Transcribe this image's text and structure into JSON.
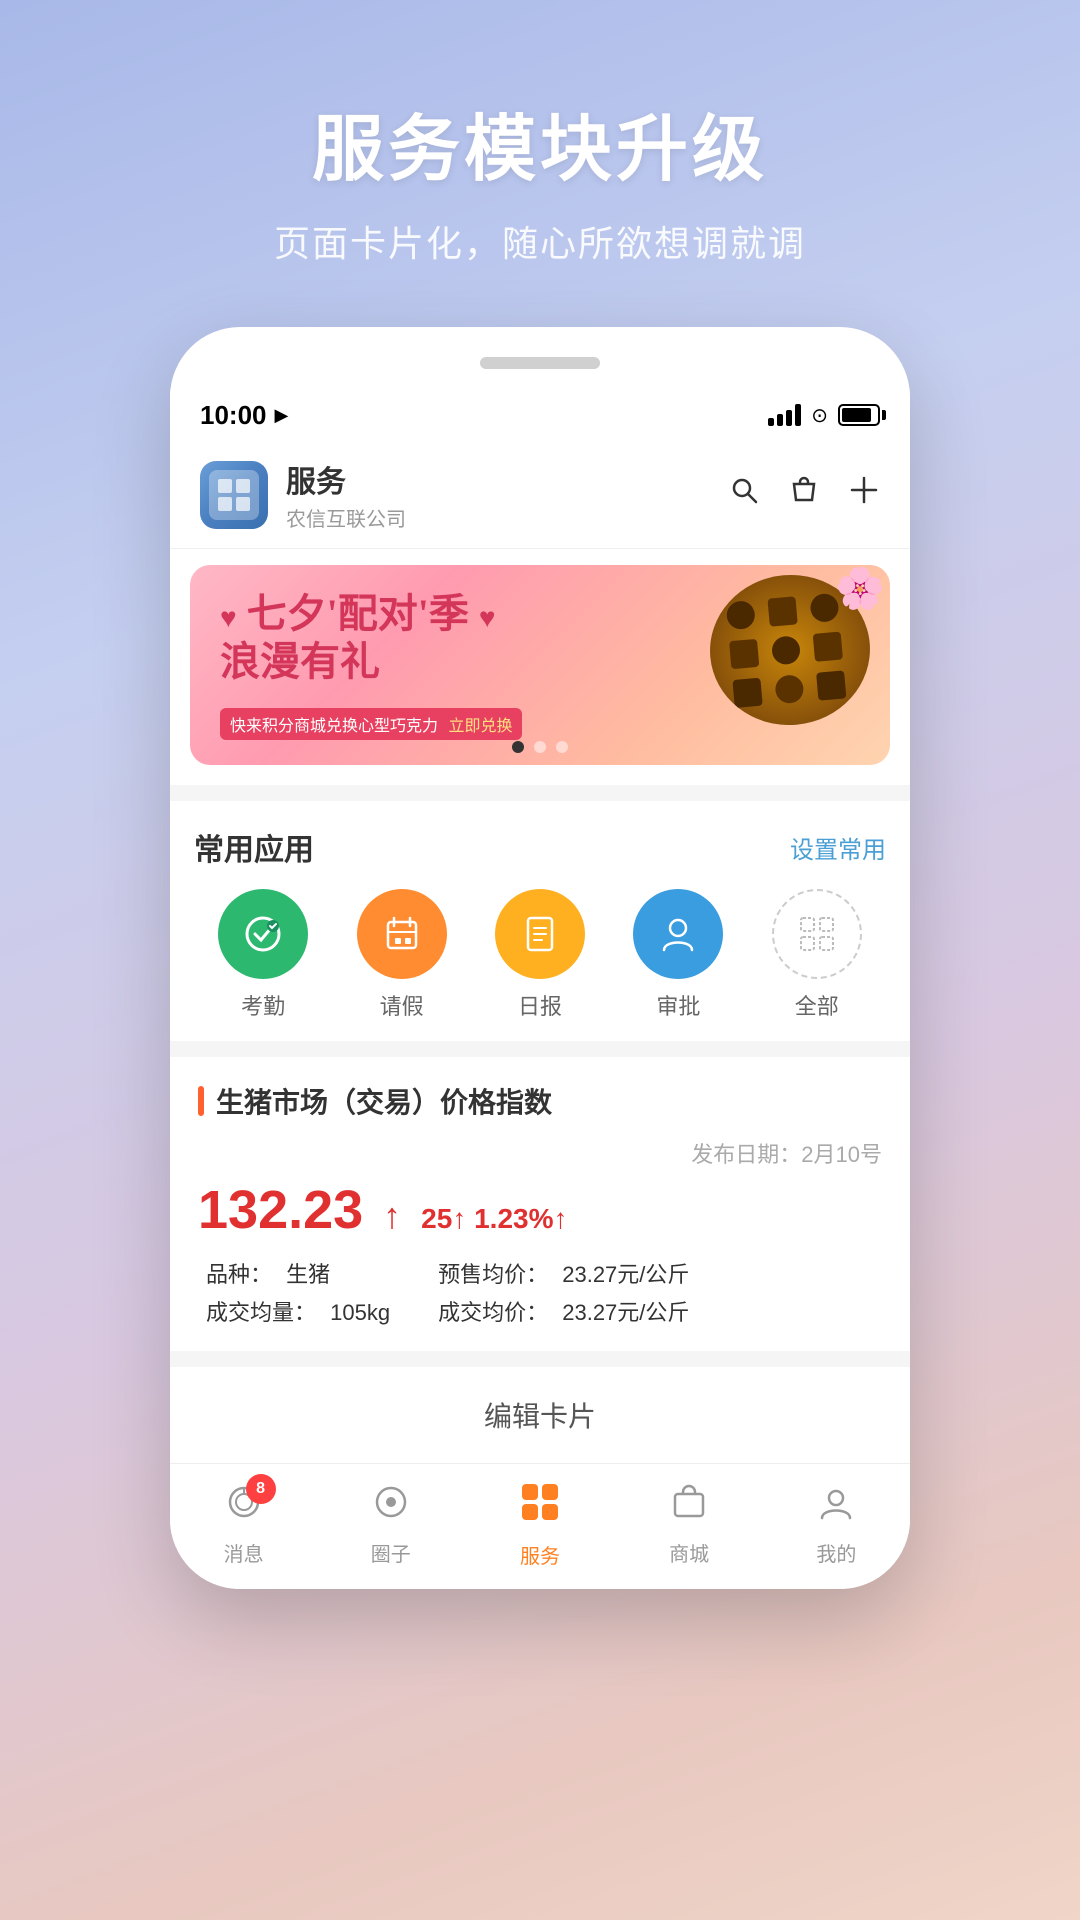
{
  "hero": {
    "title": "服务模块升级",
    "subtitle": "页面卡片化，随心所欲想调就调"
  },
  "status_bar": {
    "time": "10:00",
    "location_icon": "▶"
  },
  "app_header": {
    "title": "服务",
    "subtitle": "农信互联公司",
    "icons": [
      "search",
      "bag",
      "plus"
    ]
  },
  "banner": {
    "title_line1": "七夕'配对'季",
    "title_line2": "浪漫有礼",
    "tag": "快来积分商城兑换心型巧克力",
    "tag_link": "立即兑换",
    "dots": [
      true,
      false,
      false
    ]
  },
  "common_apps": {
    "section_title": "常用应用",
    "action_label": "设置常用",
    "items": [
      {
        "label": "考勤",
        "icon": "bluetooth",
        "color": "green"
      },
      {
        "label": "请假",
        "icon": "calendar",
        "color": "orange"
      },
      {
        "label": "日报",
        "icon": "note",
        "color": "yellow"
      },
      {
        "label": "审批",
        "icon": "person",
        "color": "blue"
      },
      {
        "label": "全部",
        "icon": "grid",
        "color": "outline"
      }
    ]
  },
  "market": {
    "title": "生猪市场（交易）价格指数",
    "date_label": "发布日期：2月10号",
    "main_price": "132.23",
    "change_points": "25",
    "change_percent": "1.23%",
    "details": [
      {
        "label": "品种：",
        "value": "生猪"
      },
      {
        "label": "成交均量：",
        "value": "105kg"
      },
      {
        "label": "预售均价：",
        "value": "23.27元/公斤"
      },
      {
        "label": "成交均价：",
        "value": "23.27元/公斤"
      }
    ]
  },
  "edit_card": {
    "label": "编辑卡片"
  },
  "bottom_nav": {
    "items": [
      {
        "label": "消息",
        "icon": "message",
        "badge": "8",
        "active": false
      },
      {
        "label": "圈子",
        "icon": "circle",
        "badge": null,
        "active": false
      },
      {
        "label": "服务",
        "icon": "apps",
        "badge": null,
        "active": true
      },
      {
        "label": "商城",
        "icon": "shop",
        "badge": null,
        "active": false
      },
      {
        "label": "我的",
        "icon": "user",
        "badge": null,
        "active": false
      }
    ]
  }
}
